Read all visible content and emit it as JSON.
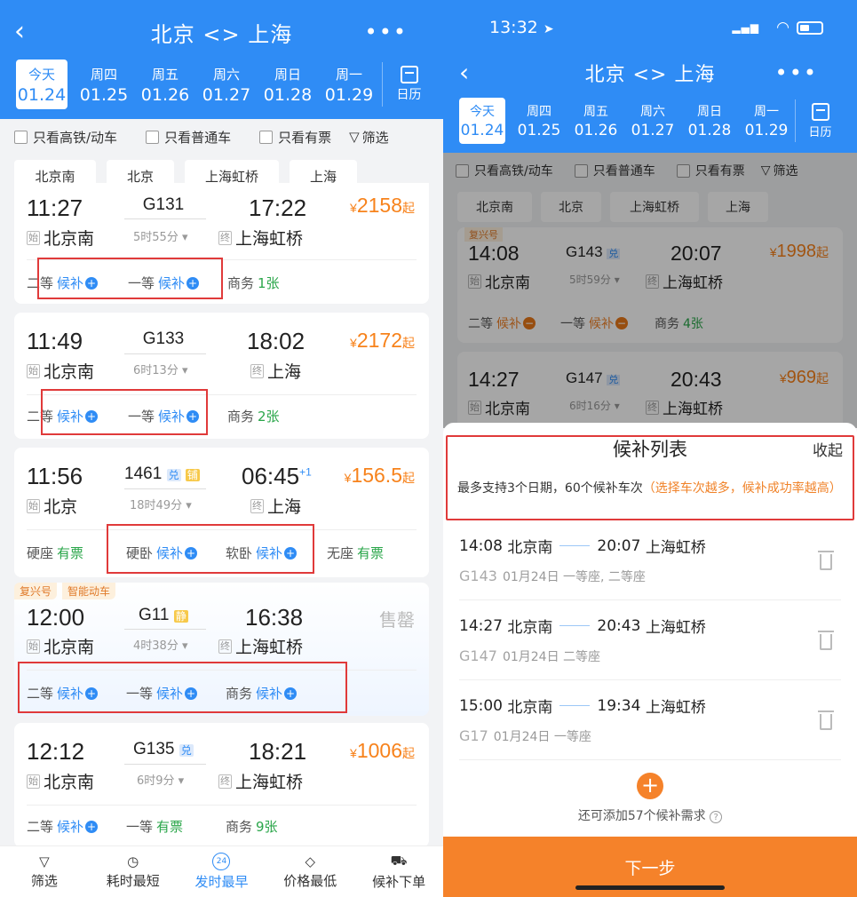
{
  "left": {
    "title": "北京 <> 上海",
    "days": [
      {
        "w": "今天",
        "d": "01.24",
        "sel": true
      },
      {
        "w": "周四",
        "d": "01.25"
      },
      {
        "w": "周五",
        "d": "01.26"
      },
      {
        "w": "周六",
        "d": "01.27"
      },
      {
        "w": "周日",
        "d": "01.28"
      },
      {
        "w": "周一",
        "d": "01.29"
      }
    ],
    "calendar": "日历",
    "filters": {
      "f1": "只看高铁/动车",
      "f2": "只看普通车",
      "f3": "只看有票",
      "f4": "筛选"
    },
    "stations": [
      "北京南",
      "北京",
      "上海虹桥",
      "上海"
    ],
    "trains": [
      {
        "dep": "11:27",
        "no": "G131",
        "arr": "17:22",
        "dur": "5时55分",
        "from": "北京南",
        "to": "上海虹桥",
        "yen": "¥",
        "price": "2158",
        "suffix": "起",
        "seats": [
          {
            "n": "二等",
            "v": "候补",
            "t": "wait"
          },
          {
            "n": "一等",
            "v": "候补",
            "t": "wait"
          },
          {
            "n": "商务",
            "v": "1张",
            "t": "ok"
          }
        ]
      },
      {
        "dep": "11:49",
        "no": "G133",
        "arr": "18:02",
        "dur": "6时13分",
        "from": "北京南",
        "to": "上海",
        "yen": "¥",
        "price": "2172",
        "suffix": "起",
        "seats": [
          {
            "n": "二等",
            "v": "候补",
            "t": "wait"
          },
          {
            "n": "一等",
            "v": "候补",
            "t": "wait"
          },
          {
            "n": "商务",
            "v": "2张",
            "t": "ok"
          }
        ]
      },
      {
        "dep": "11:56",
        "no": "1461",
        "b1": "兑",
        "b2": "铺",
        "arr": "06:45",
        "plus": "+1",
        "dur": "18时49分",
        "from": "北京",
        "to": "上海",
        "yen": "¥",
        "price": "156.5",
        "suffix": "起",
        "seats": [
          {
            "n": "硬座",
            "v": "有票",
            "t": "ok"
          },
          {
            "n": "硬卧",
            "v": "候补",
            "t": "wait"
          },
          {
            "n": "软卧",
            "v": "候补",
            "t": "wait"
          },
          {
            "n": "无座",
            "v": "有票",
            "t": "ok"
          }
        ]
      },
      {
        "tags": [
          "复兴号",
          "智能动车"
        ],
        "dep": "12:00",
        "no": "G11",
        "b1": "静",
        "arr": "16:38",
        "dur": "4时38分",
        "from": "北京南",
        "to": "上海虹桥",
        "soldout": "售罄",
        "seats": [
          {
            "n": "二等",
            "v": "候补",
            "t": "wait"
          },
          {
            "n": "一等",
            "v": "候补",
            "t": "wait"
          },
          {
            "n": "商务",
            "v": "候补",
            "t": "wait"
          }
        ]
      },
      {
        "dep": "12:12",
        "no": "G135",
        "b1": "兑",
        "arr": "18:21",
        "dur": "6时9分",
        "from": "北京南",
        "to": "上海虹桥",
        "yen": "¥",
        "price": "1006",
        "suffix": "起",
        "seats": [
          {
            "n": "二等",
            "v": "候补",
            "t": "wait"
          },
          {
            "n": "一等",
            "v": "有票",
            "t": "ok"
          },
          {
            "n": "商务",
            "v": "9张",
            "t": "ok"
          }
        ]
      }
    ],
    "start_tag": "始",
    "end_tag": "终",
    "nav": [
      {
        "l": "筛选",
        "i": "▽"
      },
      {
        "l": "耗时最短",
        "i": "◷"
      },
      {
        "l": "发时最早",
        "i": "24",
        "act": true
      },
      {
        "l": "价格最低",
        "i": "◇"
      },
      {
        "l": "候补下单",
        "i": "⛟"
      }
    ]
  },
  "right": {
    "clock": "13:32",
    "title": "北京 <> 上海",
    "days": [
      {
        "w": "今天",
        "d": "01.24",
        "sel": true
      },
      {
        "w": "周四",
        "d": "01.25"
      },
      {
        "w": "周五",
        "d": "01.26"
      },
      {
        "w": "周六",
        "d": "01.27"
      },
      {
        "w": "周日",
        "d": "01.28"
      },
      {
        "w": "周一",
        "d": "01.29"
      }
    ],
    "calendar": "日历",
    "filters": {
      "f1": "只看高铁/动车",
      "f2": "只看普通车",
      "f3": "只看有票",
      "f4": "筛选"
    },
    "stations": [
      "北京南",
      "北京",
      "上海虹桥",
      "上海"
    ],
    "bg_trains": [
      {
        "tag": "复兴号",
        "dep": "14:08",
        "no": "G143",
        "b1": "兑",
        "arr": "20:07",
        "dur": "5时59分",
        "from": "北京南",
        "to": "上海虹桥",
        "yen": "¥",
        "price": "1998",
        "suffix": "起",
        "seats": [
          {
            "n": "二等",
            "v": "候补",
            "t": "waito"
          },
          {
            "n": "一等",
            "v": "候补",
            "t": "waito"
          },
          {
            "n": "商务",
            "v": "4张",
            "t": "ok"
          }
        ]
      },
      {
        "dep": "14:27",
        "no": "G147",
        "b1": "兑",
        "arr": "20:43",
        "dur": "6时16分",
        "from": "北京南",
        "to": "上海虹桥",
        "yen": "¥",
        "price": "969",
        "suffix": "起"
      }
    ],
    "sheet": {
      "title": "候补列表",
      "collapse": "收起",
      "notice": "最多支持3个日期，60个候补车次",
      "notice_hint": "（选择车次越多，候补成功率越高）",
      "items": [
        {
          "dep": "14:08",
          "from": "北京南",
          "arr": "20:07",
          "to": "上海虹桥",
          "no": "G143",
          "info": "01月24日 一等座, 二等座"
        },
        {
          "dep": "14:27",
          "from": "北京南",
          "arr": "20:43",
          "to": "上海虹桥",
          "no": "G147",
          "info": "01月24日 二等座"
        },
        {
          "dep": "15:00",
          "from": "北京南",
          "arr": "19:34",
          "to": "上海虹桥",
          "no": "G17",
          "info": "01月24日 一等座"
        }
      ],
      "add_hint": "还可添加57个候补需求",
      "next": "下一步"
    }
  },
  "colors": {
    "blue": "#2f8cf5",
    "orange": "#f7821b",
    "green": "#2aa64a",
    "red": "#e03a3a"
  }
}
